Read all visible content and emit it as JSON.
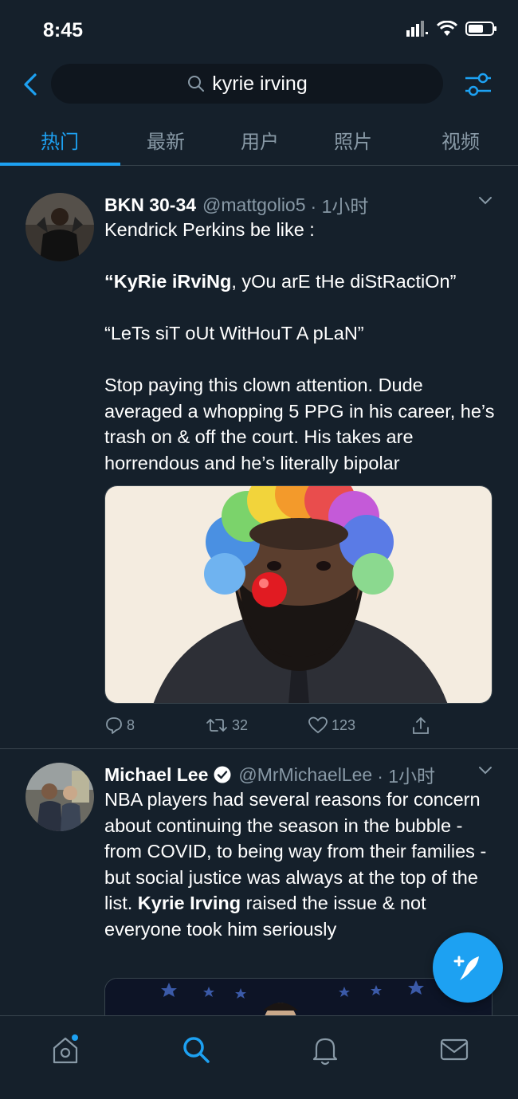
{
  "status_bar": {
    "time": "8:45"
  },
  "search": {
    "query": "kyrie irving"
  },
  "tabs": [
    {
      "label": "热门",
      "active": true
    },
    {
      "label": "最新",
      "active": false
    },
    {
      "label": "用户",
      "active": false
    },
    {
      "label": "照片",
      "active": false
    },
    {
      "label": "视频",
      "active": false
    }
  ],
  "tweets": [
    {
      "name": "BKN 30-34",
      "handle": "@mattgolio5",
      "time": "· 1小时",
      "body": {
        "line1": "Kendrick Perkins be like :",
        "quote1_bold": "“KyRie iRviNg",
        "quote1_rest": ", yOu arE tHe diStRactiOn”",
        "quote2": "“LeTs siT oUt WitHouT A pLaN”",
        "para": "Stop paying this clown attention. Dude averaged a whopping 5 PPG in his career, he’s trash on & off the court. His takes are horrendous and he’s literally bipolar"
      },
      "replies": "8",
      "retweets": "32",
      "likes": "123"
    },
    {
      "name": "Michael Lee",
      "handle": "@MrMichaelLee",
      "time": "· 1小时",
      "body": {
        "text1": "NBA players had several reasons for concern about continuing the season in the bubble - from COVID, to being way from their families - but social justice was always at the top of the list. ",
        "bold": "Kyrie Irving",
        "text2": " raised the issue & not everyone took him seriously"
      }
    }
  ],
  "colors": {
    "background": "#15202b",
    "accent": "#1da1f2",
    "secondary_text": "#8899a6",
    "divider": "#38444d"
  },
  "icons": {
    "back": "chevron-left-icon",
    "search": "search-icon",
    "filter": "sliders-icon",
    "reply": "reply-icon",
    "retweet": "retweet-icon",
    "like": "heart-icon",
    "share": "share-icon",
    "compose": "compose-icon",
    "home": "home-icon",
    "explore": "search-icon",
    "notifications": "bell-icon",
    "messages": "mail-icon"
  }
}
